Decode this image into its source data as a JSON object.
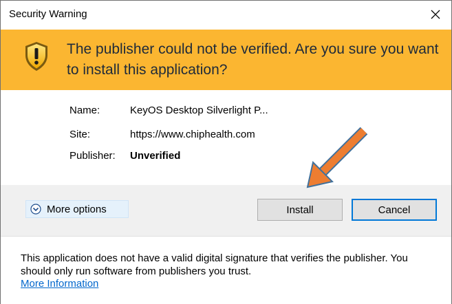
{
  "window": {
    "title": "Security Warning",
    "close_icon": "close-icon"
  },
  "banner": {
    "message": "The publisher could not be verified. Are you sure you want to install this application?",
    "icon": "warning-shield-icon",
    "color": "#fbb631"
  },
  "details": {
    "name_label": "Name:",
    "name_value": "KeyOS Desktop Silverlight P...",
    "site_label": "Site:",
    "site_value": "https://www.chiphealth.com",
    "publisher_label": "Publisher:",
    "publisher_value": "Unverified"
  },
  "actions": {
    "more_options_label": "More options",
    "more_options_icon": "chevron-down-circle-icon",
    "install_label": "Install",
    "cancel_label": "Cancel"
  },
  "annotation": {
    "arrow_icon": "orange-arrow-icon",
    "arrow_color": "#ed7d31"
  },
  "footer": {
    "message": "This application does not have a valid digital signature that verifies the publisher. You should only run software from publishers you trust.",
    "link_label": "More Information",
    "link_color": "#0066cc"
  }
}
